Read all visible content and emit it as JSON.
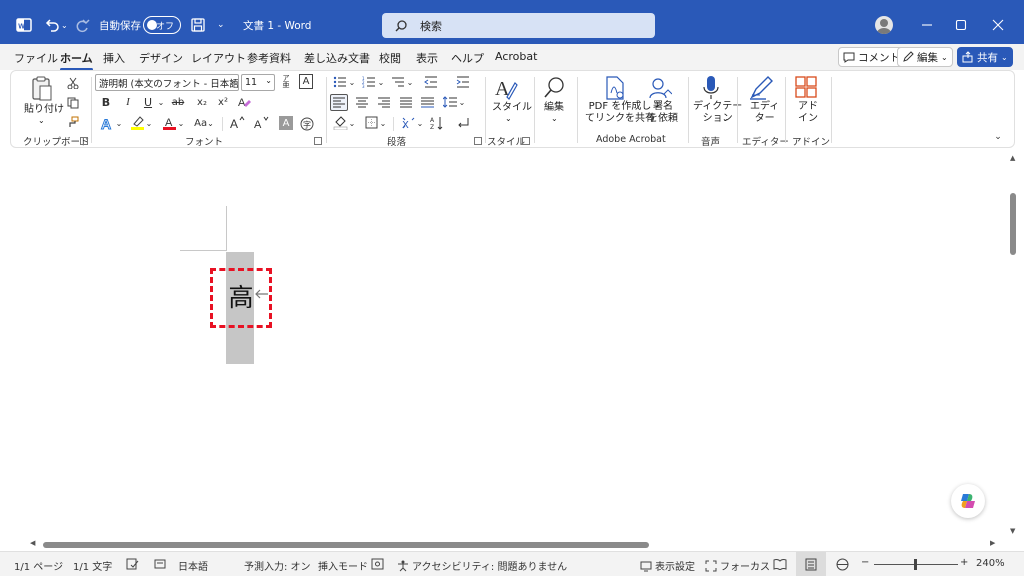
{
  "titlebar": {
    "autosave_label": "自動保存",
    "autosave_state": "オフ",
    "doc_title": "文書 1  -  Word",
    "search_placeholder": "検索"
  },
  "tabs": [
    "ファイル",
    "ホーム",
    "挿入",
    "デザイン",
    "レイアウト",
    "参考資料",
    "差し込み文書",
    "校閲",
    "表示",
    "ヘルプ",
    "Acrobat"
  ],
  "active_tab": "ホーム",
  "right_buttons": {
    "comment": "コメント",
    "edit": "編集",
    "share": "共有"
  },
  "ribbon": {
    "clipboard": {
      "paste": "貼り付け",
      "label": "クリップボード"
    },
    "font": {
      "font_name": "游明朝 (本文のフォント - 日本語)",
      "font_size": "11",
      "bold": "B",
      "italic": "I",
      "underline": "U",
      "strike": "ab",
      "subscript": "x₂",
      "superscript": "x²",
      "case": "Aa",
      "label": "フォント"
    },
    "paragraph": {
      "label": "段落"
    },
    "styles": {
      "button": "スタイル",
      "label": "スタイル"
    },
    "editing": {
      "button": "編集"
    },
    "adobe": {
      "pdf_share": "PDF を作成し\nてリンクを共有",
      "sign": "署名\nを依頼",
      "label": "Adobe Acrobat"
    },
    "voice": {
      "dictate": "ディクテー\nション",
      "label": "音声"
    },
    "editor": {
      "button": "エディ\nター",
      "label": "エディター"
    },
    "addin": {
      "button": "アド\nイン",
      "label": "アドイン"
    }
  },
  "document": {
    "text": "高",
    "return_mark": "↵"
  },
  "status": {
    "page": "1/1 ページ",
    "words": "1/1 文字",
    "language": "日本語",
    "predict": "予測入力: オン",
    "insert_mode": "挿入モード",
    "accessibility": "アクセシビリティ: 問題ありません",
    "display_settings": "表示設定",
    "focus": "フォーカス",
    "zoom": "240%"
  },
  "colors": {
    "titlebar": "#2a59b8",
    "highlight_box": "#e81123",
    "selection": "#c6c6c6"
  }
}
